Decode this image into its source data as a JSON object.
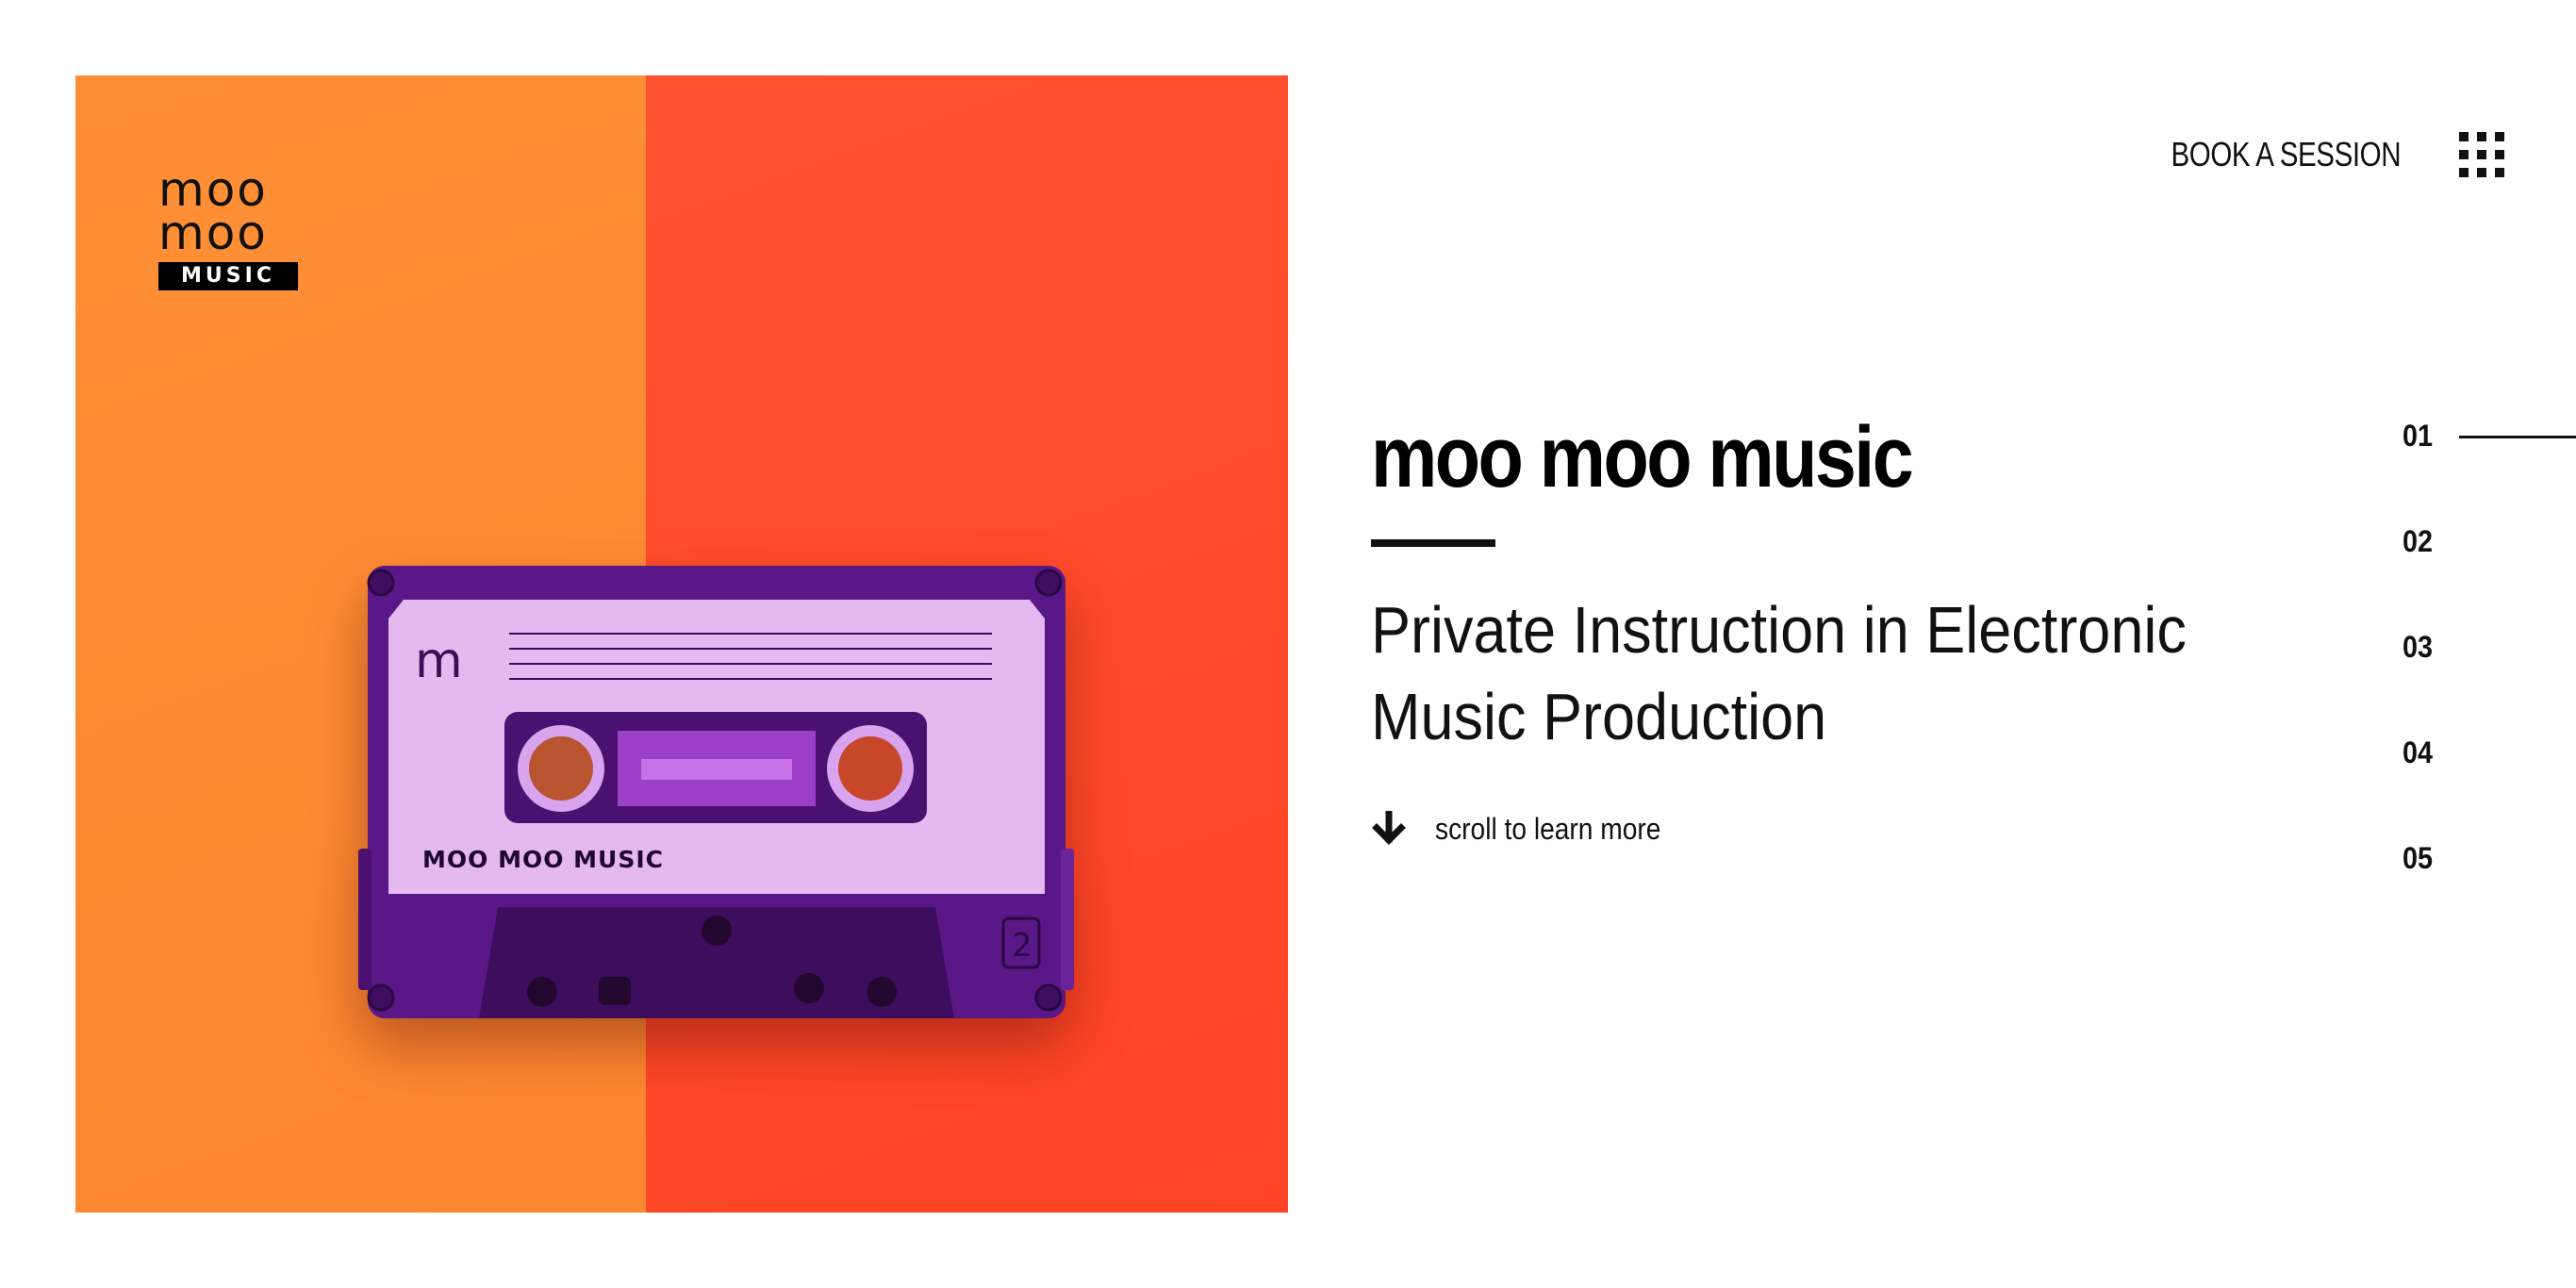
{
  "logo": {
    "line1": "moo",
    "line2": "moo",
    "badge": "MUSIC"
  },
  "hero": {
    "color_left": "#FF8A33",
    "color_right": "#FF4A2A",
    "cassette": {
      "label_letter": "m",
      "label_text": "MOO MOO MUSIC",
      "side_number": "2",
      "body_color": "#5E1A8C",
      "label_color": "#E7B9F0"
    }
  },
  "header": {
    "book_label": "BOOK A SESSION",
    "menu_icon": "grid-menu-icon"
  },
  "main": {
    "title": "moo moo music",
    "subtitle": "Private Instruction in Electronic Music Production",
    "scroll_label": "scroll to learn more",
    "scroll_icon": "arrow-down-icon"
  },
  "pager": {
    "items": [
      "01",
      "02",
      "03",
      "04",
      "05"
    ],
    "active_index": 0
  }
}
